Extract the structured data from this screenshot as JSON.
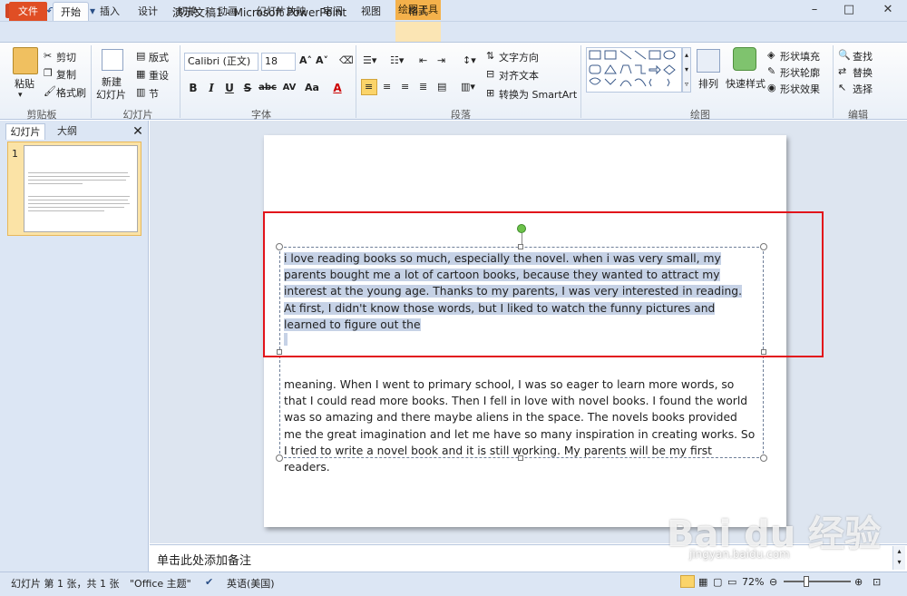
{
  "window": {
    "title": "演示文稿1 - Microsoft PowerPoint",
    "context_group": "绘图工具",
    "controls": [
      "–",
      "□",
      "✕"
    ]
  },
  "tabs": [
    "文件",
    "开始",
    "插入",
    "设计",
    "切换",
    "动画",
    "幻灯片放映",
    "审阅",
    "视图",
    "格式"
  ],
  "ribbon": {
    "clipboard": {
      "paste": "粘贴",
      "cut": "剪切",
      "copy": "复制",
      "format_painter": "格式刷",
      "label": "剪贴板"
    },
    "slides": {
      "new_slide": "新建",
      "new_slide2": "幻灯片",
      "layout": "版式",
      "reset": "重设",
      "section": "节",
      "label": "幻灯片"
    },
    "font": {
      "name": "Calibri (正文)",
      "size": "18",
      "label": "字体",
      "bold": "B",
      "italic": "I",
      "underline": "U",
      "strike": "S",
      "shadow": "abc",
      "spacing": "AV",
      "case": "Aa",
      "color": "A"
    },
    "paragraph": {
      "text_direction": "文字方向",
      "align_text": "对齐文本",
      "smartart": "转换为 SmartArt",
      "label": "段落"
    },
    "drawing": {
      "arrange": "排列",
      "quick_styles": "快速样式",
      "shape_fill": "形状填充",
      "shape_outline": "形状轮廓",
      "shape_effects": "形状效果",
      "label": "绘图"
    },
    "editing": {
      "find": "查找",
      "replace": "替换",
      "select": "选择",
      "label": "编辑"
    }
  },
  "panel": {
    "tab_slides": "幻灯片",
    "tab_outline": "大纲",
    "close": "✕",
    "slide_number": "1"
  },
  "slide": {
    "paragraph1": "i love reading books so much, especially the novel. when i was very small, my parents bought me a lot of cartoon books, because they wanted to attract my interest at the young age. Thanks to my parents, I was very interested in reading. At first, I didn't know those words, but I liked to watch the funny pictures and learned to figure out the",
    "paragraph2": "meaning. When I went to primary school, I was so eager to learn more words, so that I could read more books. Then I fell in love with novel books. I found the world was so amazing and there maybe aliens in the space. The novels books provided me the great imagination and let me have so many inspiration in creating works. So I tried to write a novel book and it is still working. My parents will be my first readers."
  },
  "notes": {
    "placeholder": "单击此处添加备注"
  },
  "status": {
    "slide_info": "幻灯片 第 1 张，共 1 张",
    "theme": "\"Office 主题\"",
    "language": "英语(美国)",
    "zoom": "72%"
  },
  "watermark": {
    "brand": "Bai du 经验",
    "url": "jingyan.baidu.com"
  }
}
